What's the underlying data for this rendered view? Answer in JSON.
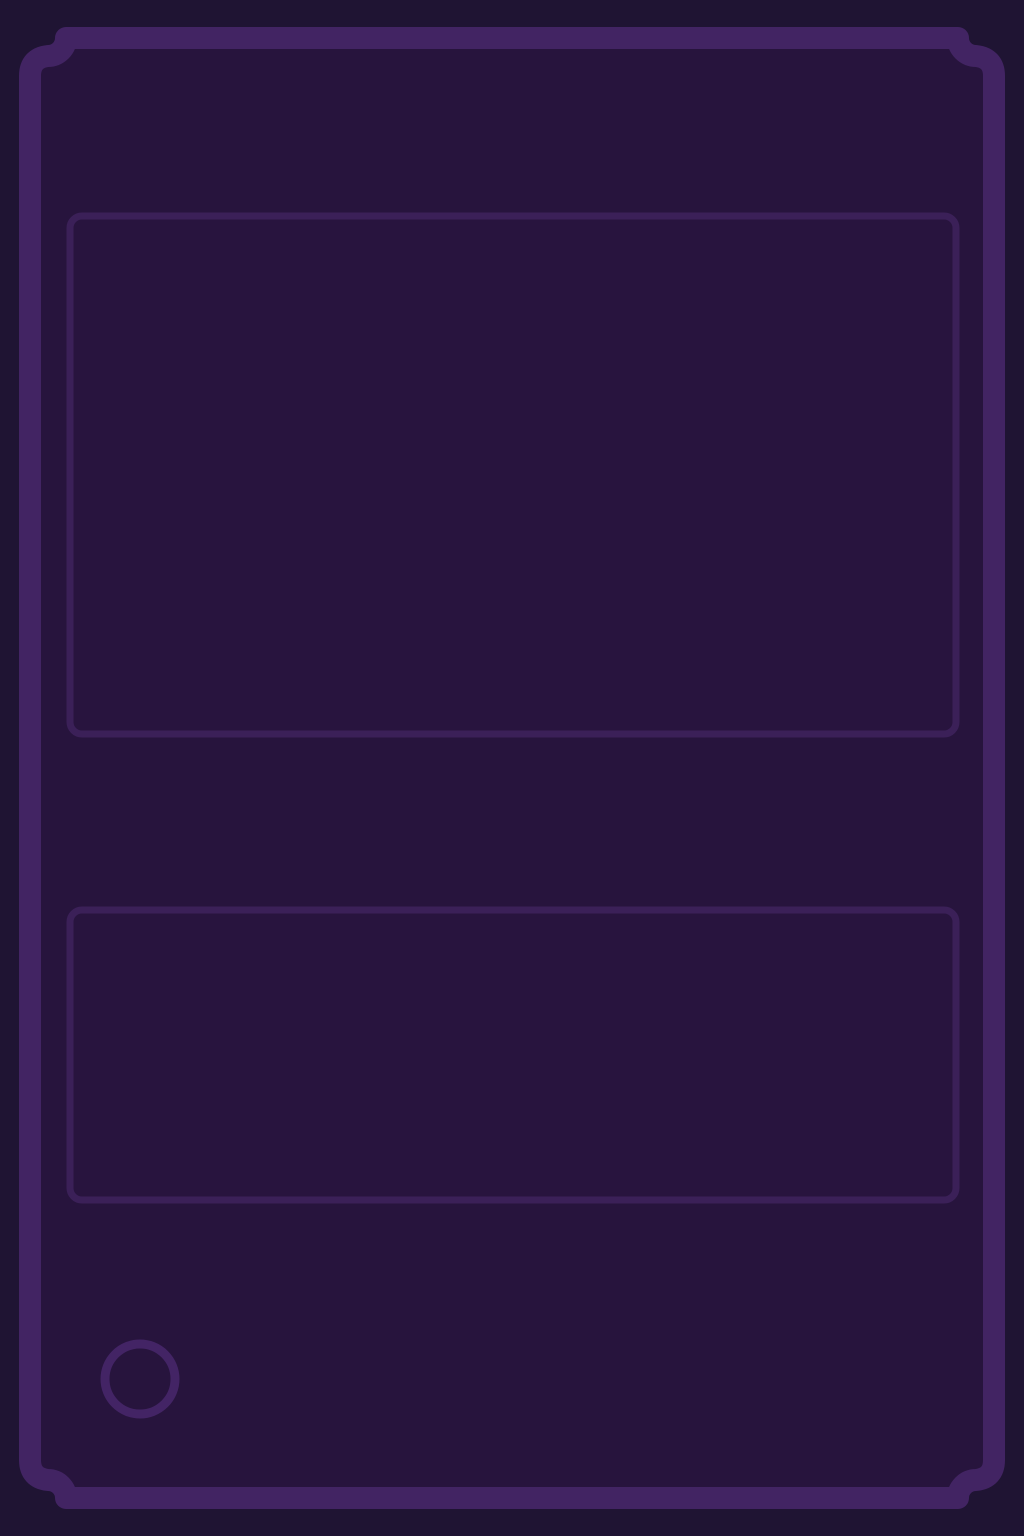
{
  "theme": {
    "page_background": "#1f1433",
    "card_fill": "#27143d",
    "frame_outline": "#422463",
    "slot_outline": "#3b2058"
  },
  "card": {
    "art_box": {
      "state": "empty"
    },
    "text_box": {
      "state": "empty"
    },
    "corner_ring": {
      "icon": "ring-icon",
      "state": "empty"
    }
  }
}
